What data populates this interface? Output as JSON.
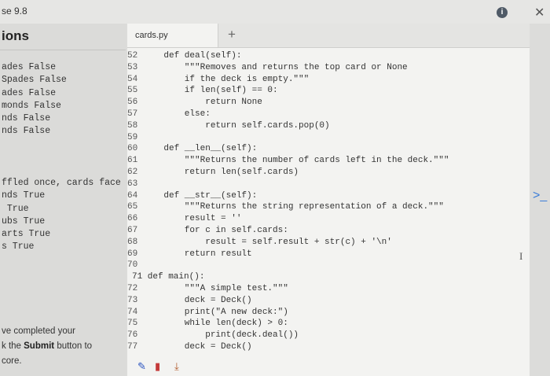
{
  "window": {
    "title": "se 9.8",
    "info_glyph": "i",
    "close_glyph": "✕"
  },
  "left_panel": {
    "heading": "ions",
    "list1": [
      "ades False",
      "Spades False",
      "ades False",
      "monds False",
      "nds False",
      "nds False"
    ],
    "list2": [
      "ffled once, cards face",
      "nds True",
      " True",
      "ubs True",
      "arts True",
      "s True"
    ],
    "instructions": {
      "line1": "ve completed your",
      "line2_pre": "k the ",
      "line2_bold": "Submit",
      "line2_post": " button to",
      "line3": "core."
    }
  },
  "editor": {
    "tab_label": "cards.py",
    "new_tab_glyph": "+",
    "cursor_glyph": "I",
    "lines": [
      {
        "num": "52",
        "text": "    def deal(self):"
      },
      {
        "num": "53",
        "text": "        \"\"\"Removes and returns the top card or None"
      },
      {
        "num": "54",
        "text": "        if the deck is empty.\"\"\""
      },
      {
        "num": "55",
        "text": "        if len(self) == 0:"
      },
      {
        "num": "56",
        "text": "            return None"
      },
      {
        "num": "57",
        "text": "        else:"
      },
      {
        "num": "58",
        "text": "            return self.cards.pop(0)"
      },
      {
        "num": "59",
        "text": ""
      },
      {
        "num": "60",
        "text": "    def __len__(self):"
      },
      {
        "num": "61",
        "text": "        \"\"\"Returns the number of cards left in the deck.\"\"\""
      },
      {
        "num": "62",
        "text": "        return len(self.cards)"
      },
      {
        "num": "63",
        "text": ""
      },
      {
        "num": "64",
        "text": "    def __str__(self):"
      },
      {
        "num": "65",
        "text": "        \"\"\"Returns the string representation of a deck.\"\"\""
      },
      {
        "num": "66",
        "text": "        result = ''"
      },
      {
        "num": "67",
        "text": "        for c in self.cards:"
      },
      {
        "num": "68",
        "text": "            result = self.result + str(c) + '\\n'"
      },
      {
        "num": "69",
        "text": "        return result"
      },
      {
        "num": "70",
        "text": ""
      },
      {
        "num": "",
        "text": "71 def main():"
      },
      {
        "num": "72",
        "text": "        \"\"\"A simple test.\"\"\""
      },
      {
        "num": "73",
        "text": "        deck = Deck()"
      },
      {
        "num": "74",
        "text": "        print(\"A new deck:\")"
      },
      {
        "num": "75",
        "text": "        while len(deck) > 0:"
      },
      {
        "num": "76",
        "text": "            print(deck.deal())"
      },
      {
        "num": "77",
        "text": "        deck = Deck()"
      }
    ]
  },
  "toolbar": {
    "pencil_icon": "pencil-icon",
    "trash_icon": "trash-icon",
    "download_icon": "download-icon",
    "pencil_glyph": "✎",
    "trash_glyph": "▮",
    "download_glyph": "⤓"
  },
  "right_edge": {
    "expander_glyph": ">_"
  },
  "colors": {
    "keyword": "#1f3a8a",
    "pencil": "#2c55c0",
    "trash": "#c43a3a",
    "download": "#b05a2a",
    "expander": "#3b7dd8"
  }
}
